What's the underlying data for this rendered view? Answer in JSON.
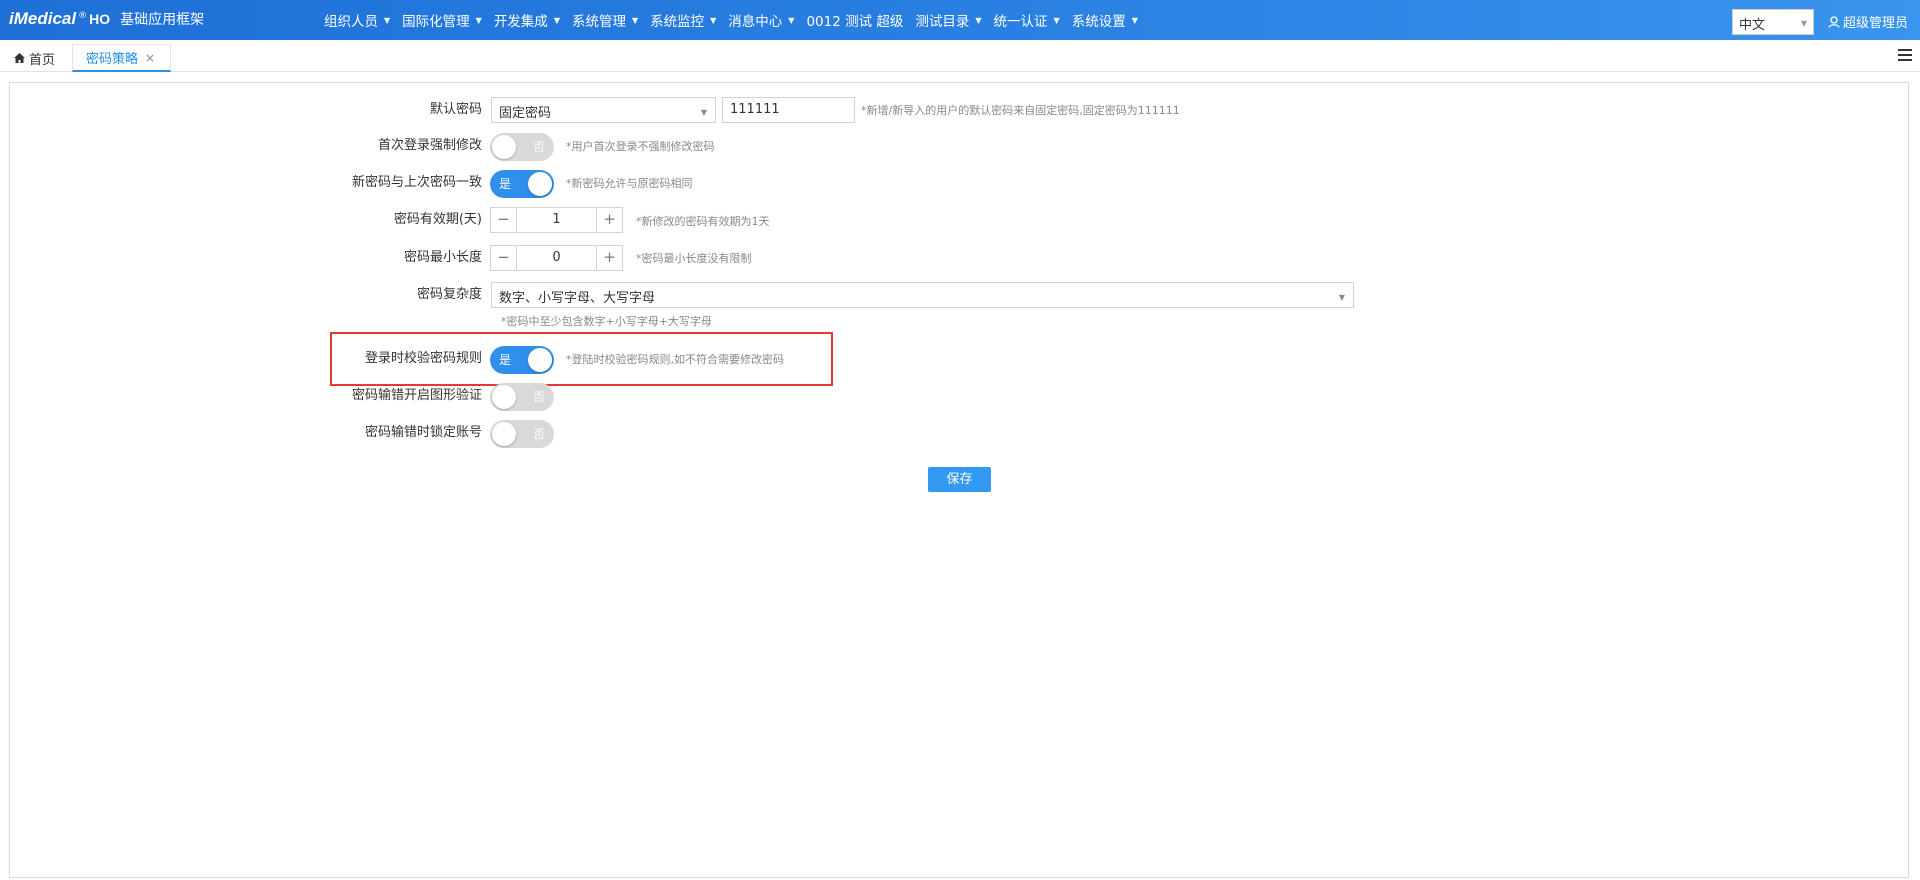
{
  "header": {
    "logo": "iMedical",
    "logo_reg": "®",
    "logo_suffix": "HO",
    "system_name": "基础应用框架",
    "menu": [
      {
        "label": "组织人员",
        "caret": "▼"
      },
      {
        "label": "国际化管理",
        "caret": "▼"
      },
      {
        "label": "开发集成",
        "caret": "▼"
      },
      {
        "label": "系统管理",
        "caret": "▼"
      },
      {
        "label": "系统监控",
        "caret": "▼"
      },
      {
        "label": "消息中心",
        "caret": "▼"
      },
      {
        "label": "0012 测试 超级",
        "caret": ""
      },
      {
        "label": "测试目录",
        "caret": "▼"
      },
      {
        "label": "统一认证",
        "caret": "▼"
      },
      {
        "label": "系统设置",
        "caret": "▼"
      }
    ],
    "language": "中文",
    "user": "超级管理员"
  },
  "tabs": {
    "home": "首页",
    "active": "密码策略",
    "close": "×"
  },
  "form": {
    "default_password": {
      "label": "默认密码",
      "mode": "固定密码",
      "value": "111111",
      "hint": "*新增/新导入的用户的默认密码来自固定密码,固定密码为111111"
    },
    "first_login_force_change": {
      "label": "首次登录强制修改",
      "state": "否",
      "hint": "*用户首次登录不强制修改密码"
    },
    "same_as_last": {
      "label": "新密码与上次密码一致",
      "state": "是",
      "hint": "*新密码允许与原密码相同"
    },
    "validity_days": {
      "label": "密码有效期(天)",
      "value": "1",
      "hint": "*新修改的密码有效期为1天"
    },
    "min_length": {
      "label": "密码最小长度",
      "value": "0",
      "hint": "*密码最小长度没有限制"
    },
    "complexity": {
      "label": "密码复杂度",
      "value": "数字、小写字母、大写字母",
      "hint": "*密码中至少包含数字+小写字母+大写字母"
    },
    "login_validate_rules": {
      "label": "登录时校验密码规则",
      "state": "是",
      "hint": "*登陆时校验密码规则,如不符合需要修改密码"
    },
    "captcha_on_error": {
      "label": "密码输错开启图形验证",
      "state": "否"
    },
    "lock_on_error": {
      "label": "密码输错时锁定账号",
      "state": "否"
    },
    "stepper_minus": "−",
    "stepper_plus": "+",
    "save_button": "保存"
  },
  "colors": {
    "accent": "#2f8fea",
    "highlight_border": "#e53935"
  }
}
